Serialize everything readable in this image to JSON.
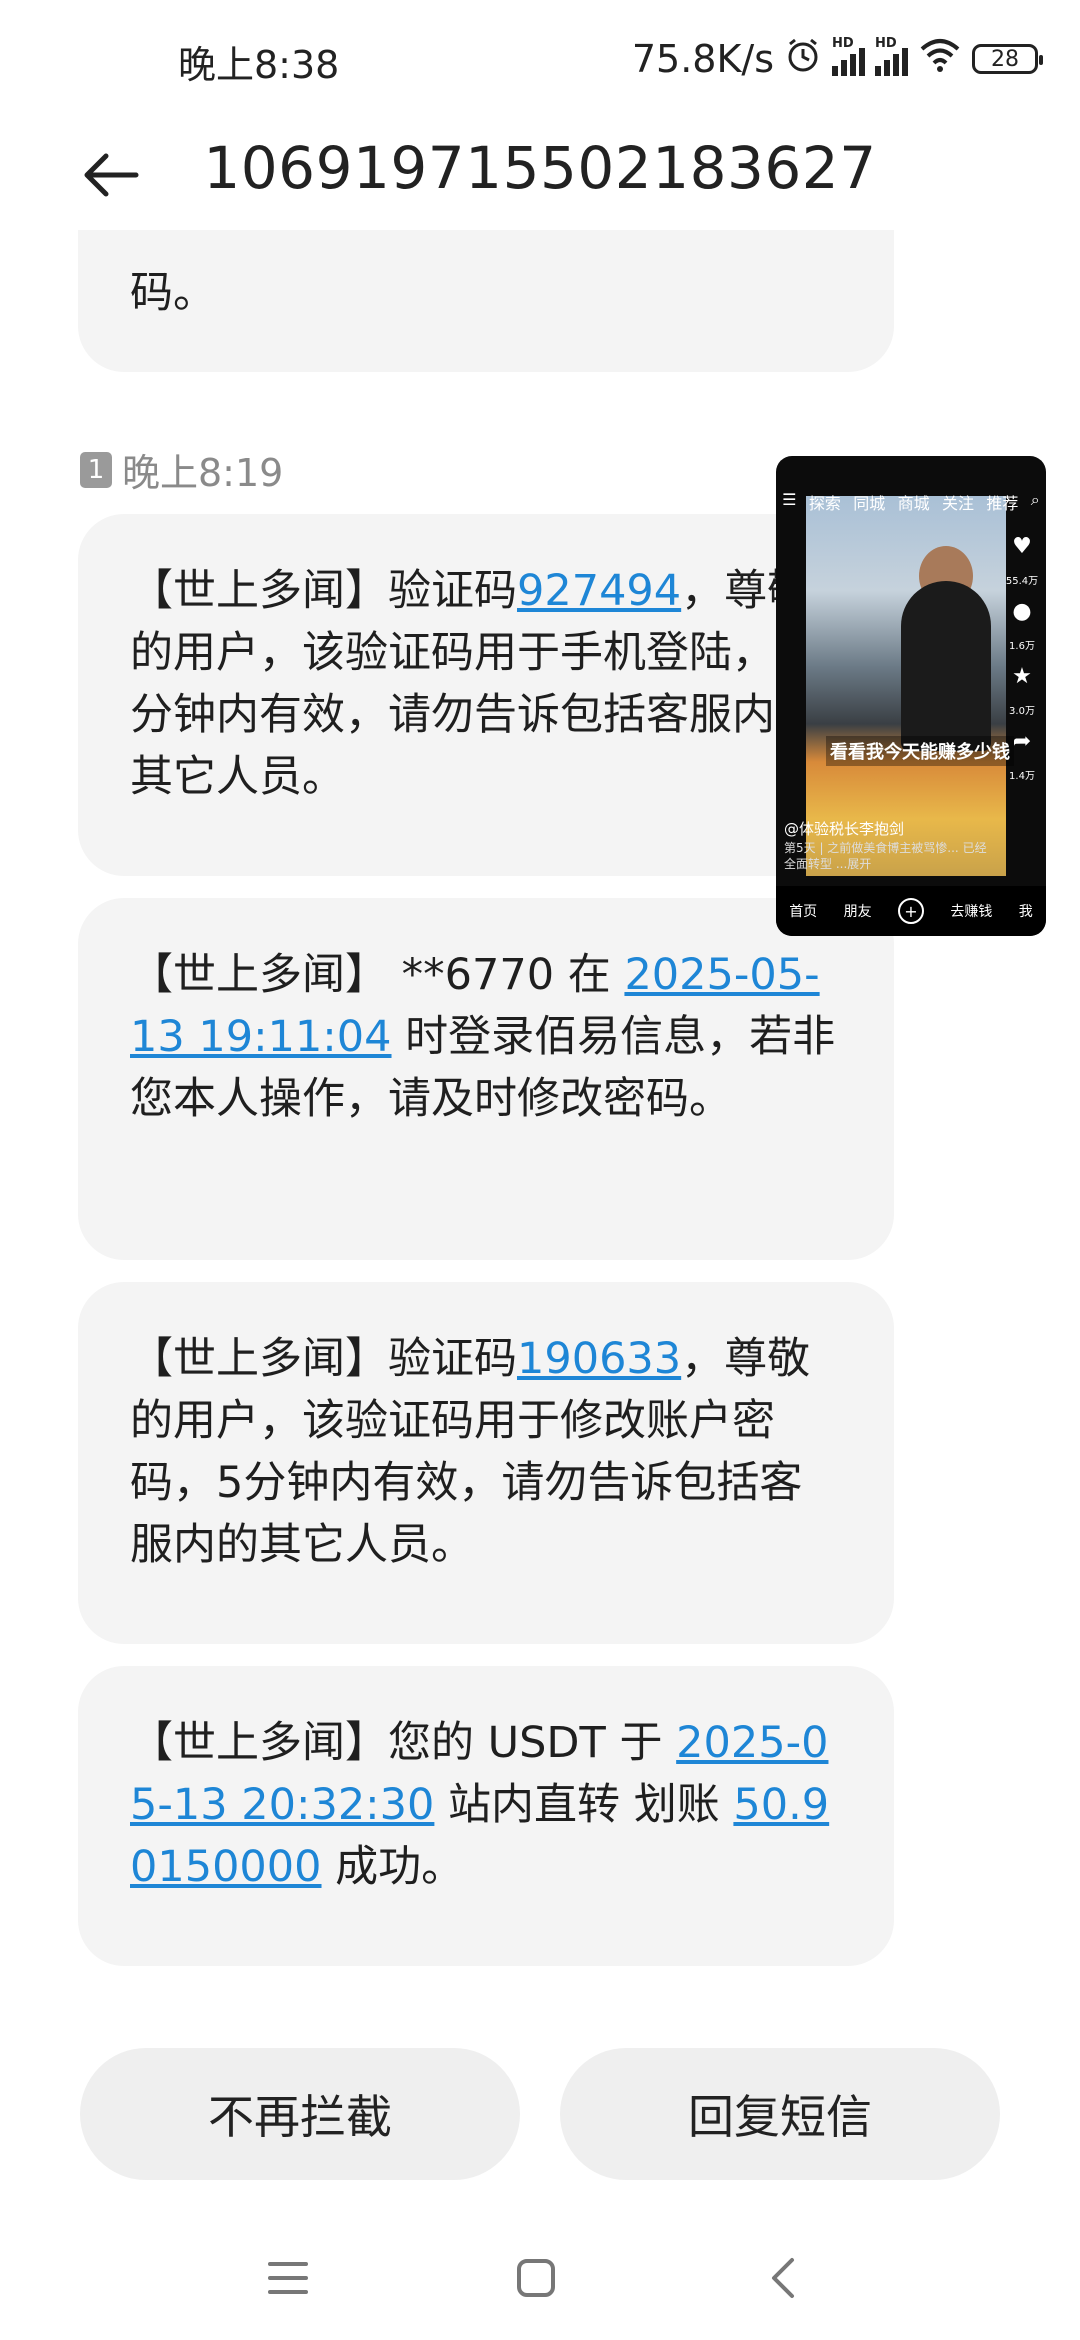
{
  "status_bar": {
    "time": "晚上8:38",
    "network_speed": "75.8K/s",
    "signal_badge": "HD",
    "battery": "28",
    "icons": [
      "alarm-icon",
      "signal-hd-icon",
      "signal-hd-icon",
      "wifi-icon",
      "battery-icon"
    ]
  },
  "header": {
    "title": "10691971550218362​7",
    "back_icon": "arrow-left-icon"
  },
  "thread": {
    "partial_message": "码。",
    "timestamp": {
      "sim": "1",
      "time": "晚上8:19"
    },
    "messages": [
      {
        "before": "【世上多闻】验证码",
        "link": "927494",
        "after": "，尊敬的用户，该验证码用于手机登陆，5分钟内有效，请勿告诉包括客服内的其它人员。"
      },
      {
        "before": "【世上多闻】 **6770 在 ",
        "link": "2025-05-13 19:11:04",
        "after": " 时登录佰易信息，若非您本人操作，请及时修改密码。"
      },
      {
        "before": "【世上多闻】验证码",
        "link": "190633",
        "after": "，尊敬的用户，该验证码用于修改账户密码，5分钟内有效，请勿告诉包括客服内的其它人员。"
      },
      {
        "before": "【世上多闻】您的 USDT 于 ",
        "link": "2025-05-13 20:32:30",
        "middle": " 站内直转 划账 ",
        "link2": "50.90150000",
        "after": " 成功。"
      }
    ]
  },
  "pip_video": {
    "tabs": [
      "探索",
      "同城",
      "商城",
      "关注",
      "推荐"
    ],
    "caption": "看看我今天能赚多少钱",
    "author": "@体验税长李抱剑",
    "description": "第5天 | 之前做美食博主被骂惨... 已经全面转型 ...展开",
    "side_counts": [
      "55.4万",
      "1.6万",
      "3.0万",
      "1.4万"
    ],
    "nav": [
      "首页",
      "朋友",
      "+",
      "去赚钱",
      "我"
    ]
  },
  "actions": {
    "unblock": "不再拦截",
    "reply": "回复短信"
  },
  "navbar": {
    "icons": [
      "menu-icon",
      "home-square-icon",
      "back-chevron-icon"
    ]
  }
}
